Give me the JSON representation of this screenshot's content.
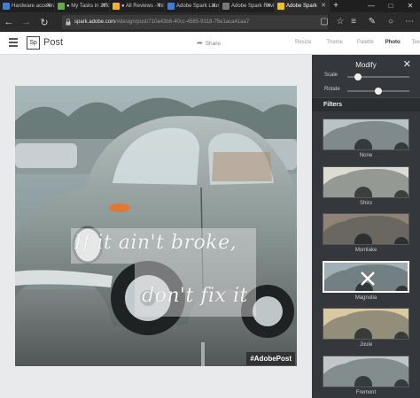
{
  "browser": {
    "tabs": [
      {
        "label": "Hardware accelera",
        "favicon": "blue"
      },
      {
        "label": "● My Tasks in ztffd",
        "favicon": "green"
      },
      {
        "label": "● All Reviews - Ini",
        "favicon": "orange"
      },
      {
        "label": "Adobe Spark Laur",
        "favicon": "blue"
      },
      {
        "label": "Adobe Spark Revi",
        "favicon": "grey"
      },
      {
        "label": "Adobe Spark",
        "favicon": "yellow",
        "active": true
      }
    ],
    "new_tab_label": "+",
    "window_controls": [
      "—",
      "□",
      "✕"
    ],
    "url_domain": "spark.adobe.com",
    "url_path": "/#design/post/710a43b6-40cc-4585-9318-75e1aca41aa7",
    "nav_icons": [
      "arrow-left-icon",
      "arrow-right-icon",
      "refresh-icon"
    ]
  },
  "app": {
    "logo_text": "Sp",
    "title": "Post",
    "share_label": "Share",
    "menu": [
      {
        "label": "Resize",
        "active": false
      },
      {
        "label": "Theme",
        "active": false
      },
      {
        "label": "Palette",
        "active": false
      },
      {
        "label": "Photo",
        "active": true
      },
      {
        "label": "Text",
        "active": false
      }
    ]
  },
  "canvas": {
    "quote_line1": "If it ain't broke,",
    "quote_line2": "don't fix it",
    "hashtag": "#AdobePost"
  },
  "panel": {
    "title": "Modify",
    "scale_label": "Scale",
    "scale_value": 0.17,
    "rotate_label": "Rotate",
    "rotate_value": 0.5,
    "filters_heading": "Filters",
    "filters": [
      {
        "name": "None",
        "tint": "#b9c2c6",
        "selected": false
      },
      {
        "name": "Shiro",
        "tint": "#dcdcd2",
        "selected": false
      },
      {
        "name": "Montlake",
        "tint": "#8f8276",
        "selected": false
      },
      {
        "name": "Magnolia",
        "tint": "#9fb0b6",
        "selected": true
      },
      {
        "name": "Joule",
        "tint": "#d9c8a2",
        "selected": false
      },
      {
        "name": "Fremont",
        "tint": "#c0c6c9",
        "selected": false
      }
    ]
  },
  "colors": {
    "panel_bg": "#34383c",
    "browser_bg": "#1f1f1f",
    "accent_yellow": "#f6b026"
  }
}
